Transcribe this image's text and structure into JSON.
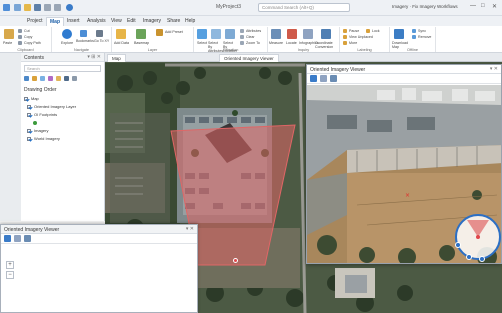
{
  "titlebar": {
    "doc_title": "MyProject3",
    "search_placeholder": "Command Search (Alt+Q)",
    "user": "Imagery · Fix Imagery Workflows",
    "minimize": "—",
    "maximize": "□",
    "close": "✕"
  },
  "menu": {
    "tabs": [
      "Project",
      "Map",
      "Insert",
      "Analysis",
      "View",
      "Edit",
      "Imagery",
      "Share",
      "Help"
    ]
  },
  "ribbon": {
    "groups": [
      {
        "name": "clipboard",
        "label": "Clipboard",
        "items": [
          "Paste",
          "Cut",
          "Copy",
          "Copy Path"
        ]
      },
      {
        "name": "navigate",
        "label": "Navigate",
        "items": [
          "Explore",
          "Bookmarks",
          "Go To XY"
        ]
      },
      {
        "name": "layer",
        "label": "Layer",
        "items": [
          "Add Data",
          "Basemap",
          "Add Preset"
        ]
      },
      {
        "name": "selection",
        "label": "Selection",
        "items": [
          "Select",
          "Select By Attributes",
          "Select By Location",
          "Attributes",
          "Clear",
          "Zoom To"
        ]
      },
      {
        "name": "inquiry",
        "label": "Inquiry",
        "items": [
          "Measure",
          "Locate",
          "Infographics",
          "Coordinate Conversion"
        ]
      },
      {
        "name": "labeling",
        "label": "Labeling",
        "items": [
          "Pause",
          "Lock",
          "View Unplaced",
          "More"
        ]
      },
      {
        "name": "offline",
        "label": "Offline",
        "items": [
          "Download Map",
          "Sync",
          "Remove"
        ]
      }
    ]
  },
  "contents": {
    "title": "Contents",
    "search_placeholder": "Search",
    "section": "Drawing Order",
    "layers": [
      {
        "label": "Map",
        "checked": true
      },
      {
        "label": "Oriented Imagery Layer",
        "checked": true
      },
      {
        "label": "OI Footprints",
        "checked": true
      },
      {
        "label": "Imagery",
        "checked": true
      },
      {
        "label": "World Imagery",
        "checked": true
      }
    ]
  },
  "map": {
    "tab_label": "Map",
    "tab2_label": "Oriented Imagery Viewer",
    "footprint_color": "#e06666",
    "photo_marker_color": "#e0474c"
  },
  "oriented_viewer_top": {
    "title": "Oriented Imagery Viewer",
    "pin": "▾ ✕"
  },
  "oriented_viewer_bottom": {
    "title": "Oriented Imagery Viewer",
    "pin": "▾ ✕",
    "zoom_in": "+",
    "zoom_out": "−"
  },
  "colors": {
    "accent": "#2c6fc4",
    "footprint": "#e06666"
  }
}
